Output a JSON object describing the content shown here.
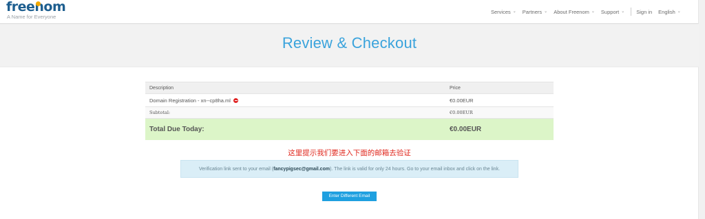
{
  "header": {
    "logo_text": "freenom",
    "tagline": "A Name for Everyone",
    "nav": [
      {
        "label": "Services",
        "has_chevron": true
      },
      {
        "label": "Partners",
        "has_chevron": true
      },
      {
        "label": "About Freenom",
        "has_chevron": true
      },
      {
        "label": "Support",
        "has_chevron": true
      }
    ],
    "sign_in": "Sign in",
    "language": "English",
    "brand_color": "#1d5e8f",
    "accent_color": "#f2a900"
  },
  "page_title": "Review & Checkout",
  "cart": {
    "columns": [
      "Description",
      "Price"
    ],
    "items": [
      {
        "description": "Domain Registration - xn--cp8ha.ml",
        "price": "€0.00EUR",
        "remove_icon": "remove-icon"
      }
    ],
    "subtotal_label": "Subtotal:",
    "subtotal_value": "€0.00EUR",
    "total_label": "Total Due Today:",
    "total_value": "€0.00EUR",
    "total_bg_color": "#dcf5c8"
  },
  "annotation": "这里提示我们要进入下面的邮箱去验证",
  "alert": {
    "prefix": "Verification link sent to your email (",
    "email": "fancypigsec@gmail.com",
    "suffix": "). The link is valid for only 24 hours. Go to your email inbox and click on the link."
  },
  "button_label": "Enter Different Email",
  "button_color": "#1fa0e0",
  "title_color": "#3aa3dc"
}
